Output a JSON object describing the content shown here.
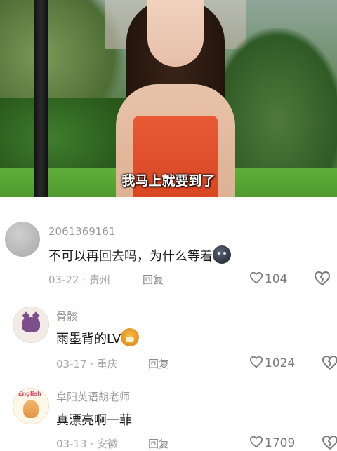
{
  "video": {
    "caption": "我马上就要到了"
  },
  "comments": [
    {
      "username": "2061369161",
      "text": "不可以再回去吗，为什么等着",
      "emoji": "sad-face-emoji",
      "date": "03-22",
      "location": "贵州",
      "reply_label": "回复",
      "likes": "104"
    },
    {
      "username": "骨骸",
      "text": "雨墨背的LV",
      "emoji": "dog-emoji",
      "date": "03-17",
      "location": "重庆",
      "reply_label": "回复",
      "likes": "1024"
    },
    {
      "username": "阜阳英语胡老师",
      "text": "真漂亮啊一菲",
      "avatar_text": "English",
      "date": "03-13",
      "location": "安徽",
      "reply_label": "回复",
      "likes": "1709"
    }
  ],
  "meta_separator": " · ",
  "colors": {
    "name": "#9a9a9a",
    "text": "#1a1a1a",
    "meta": "#a6a6a6",
    "caption": "#ffffff"
  }
}
